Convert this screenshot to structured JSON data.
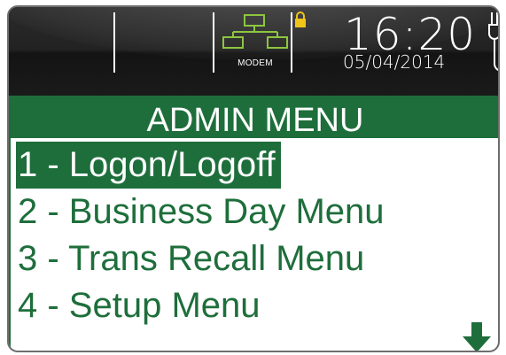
{
  "status_bar": {
    "modem_label": "MODEM",
    "time": "16:20",
    "date": "05/04/2014",
    "icons": [
      "network-icon",
      "lock-icon",
      "power-plug-icon"
    ]
  },
  "menu": {
    "title": "ADMIN MENU",
    "items": [
      {
        "label": "1 - Logon/Logoff",
        "selected": true
      },
      {
        "label": "2 - Business Day Menu",
        "selected": false
      },
      {
        "label": "3 - Trans Recall Menu",
        "selected": false
      },
      {
        "label": "4 - Setup Menu",
        "selected": false
      }
    ],
    "scroll_icon": "down-arrow-icon"
  },
  "colors": {
    "accent_green": "#1e6e3b",
    "network_icon": "#8dc63f",
    "lock_icon": "#f0c419",
    "status_bar_bg": "#1b1b1b"
  }
}
